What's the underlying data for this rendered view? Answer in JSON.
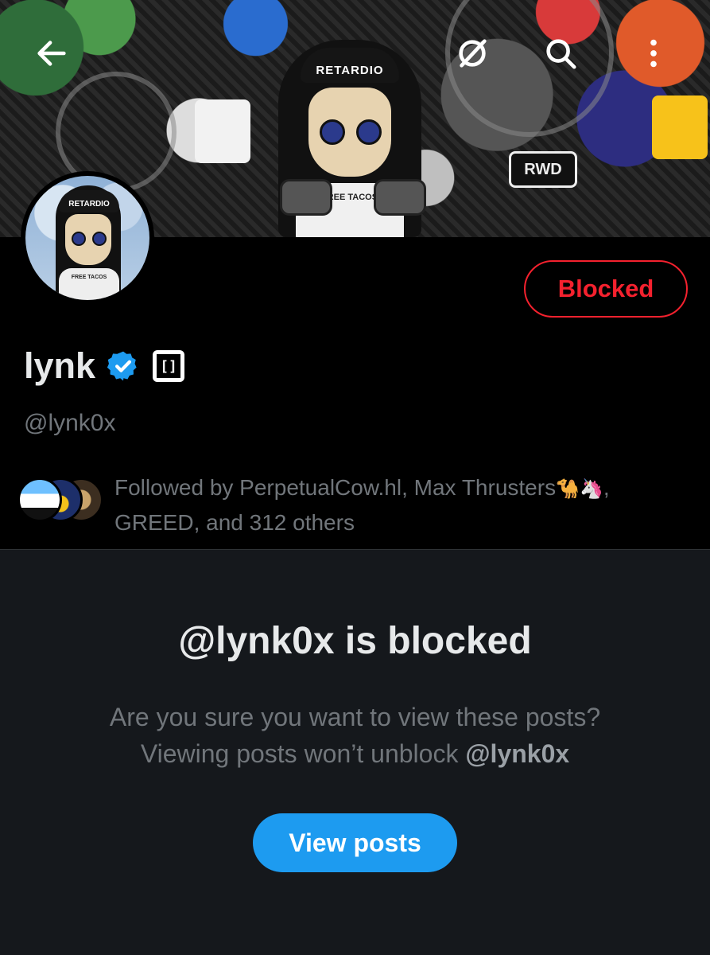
{
  "banner": {
    "cap_text": "RETARDIO",
    "shirt_text": "FREE TACOS",
    "sticker_text": "RWD"
  },
  "topbar": {
    "back_icon": "arrow-left-icon",
    "grok_icon": "grok-icon",
    "search_icon": "search-icon",
    "more_icon": "more-vertical-icon"
  },
  "profile": {
    "avatar_cap_text": "RETARDIO",
    "avatar_shirt_text": "FREE TACOS",
    "block_status": "Blocked",
    "display_name": "lynk",
    "handle": "@lynk0x",
    "affiliate_badge": "[]",
    "followed_by_prefix": "Followed by PerpetualCow.hl, Max Thrusters",
    "followed_by_emoji": "🐪🦄",
    "followed_by_suffix": ", GREED, and 312 others"
  },
  "blocked_notice": {
    "title": "@lynk0x is blocked",
    "line1": "Are you sure you want to view these posts?",
    "line2_prefix": "Viewing posts won’t unblock ",
    "line2_handle": "@lynk0x",
    "button": "View posts"
  },
  "colors": {
    "accent": "#1d9bf0",
    "blocked_red": "#f4212e",
    "muted_text": "#71767b"
  }
}
